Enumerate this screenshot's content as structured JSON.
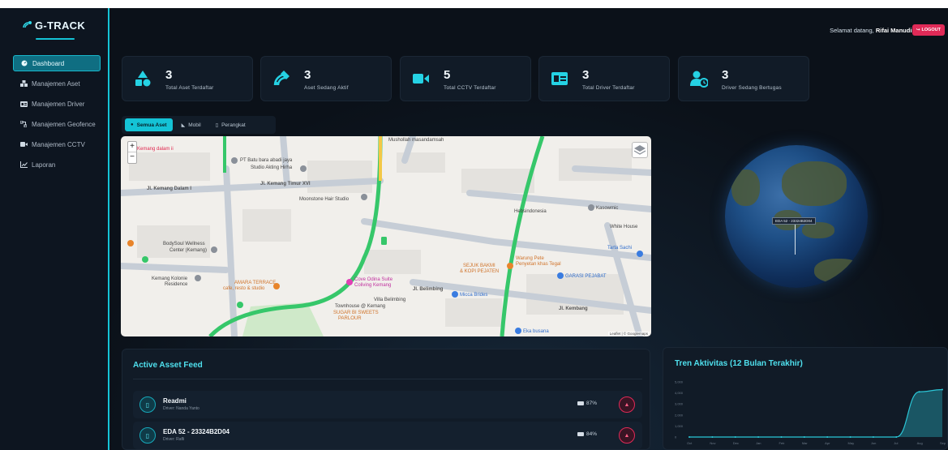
{
  "brand": {
    "name": "G-TRACK"
  },
  "nav": [
    {
      "label": "Dashboard",
      "icon": "dashboard-icon",
      "active": true
    },
    {
      "label": "Manajemen Aset",
      "icon": "assets-icon"
    },
    {
      "label": "Manajemen Driver",
      "icon": "id-card-icon"
    },
    {
      "label": "Manajemen Geofence",
      "icon": "geofence-icon"
    },
    {
      "label": "Manajemen CCTV",
      "icon": "video-icon"
    },
    {
      "label": "Laporan",
      "icon": "chart-icon"
    }
  ],
  "header": {
    "greeting": "Selamat datang,",
    "user": "Rifai Manudin",
    "logout": "LOGOUT"
  },
  "stats": [
    {
      "value": "3",
      "label": "Total Aset Terdaftar",
      "icon": "shapes-icon"
    },
    {
      "value": "3",
      "label": "Aset Sedang Aktif",
      "icon": "satellite-icon"
    },
    {
      "value": "5",
      "label": "Total CCTV Terdaftar",
      "icon": "video-icon"
    },
    {
      "value": "3",
      "label": "Total Driver Terdaftar",
      "icon": "id-card-icon"
    },
    {
      "value": "3",
      "label": "Driver Sedang Bertugas",
      "icon": "user-clock-icon"
    }
  ],
  "filters": [
    {
      "label": "Semua Aset",
      "icon": "globe-icon",
      "active": true
    },
    {
      "label": "Mobil",
      "icon": "car-icon"
    },
    {
      "label": "Perangkat",
      "icon": "device-icon"
    }
  ],
  "map": {
    "labels": [
      "Kemang dalam ii",
      "PT Batu bara abadi jaya",
      "Studio Akting Hirha",
      "Jl. Kemang Dalam I",
      "Jl. Kemang Timur XVI",
      "Moonstone Hair Studio",
      "Mushollah masandamsah",
      "Hebsindonesia",
      "Kasowmic",
      "White House",
      "BodySoul Wellness",
      "Center (Kemang)",
      "Kemang Kolonie",
      "Residence",
      "AMARA TERRACE",
      "cafe, resto & studio",
      "Cove Odina Suite",
      "Coliving Kemang",
      "Jl. Belimbing",
      "Micca Brides",
      "SEJUK BAKMI",
      "& KOPI PEJATEN",
      "Warung Pete",
      "Penyetan khas Tegal",
      "GARASI PEJABAT",
      "Tarta Sachi",
      "Villa Belimbing",
      "Townhouse @ Kemang",
      "SUGAR BI SWEETS",
      "PARLOUR",
      "Eka busana",
      "Jl. Kembang"
    ],
    "zoom_in": "+",
    "zoom_out": "−",
    "attribution": "Leaflet | © Googlemaps"
  },
  "globe": {
    "marker_label": "EDA 52 - 23324B2D04"
  },
  "feed": {
    "title": "Active Asset Feed",
    "rows": [
      {
        "name": "Readmi",
        "driver": "Driver: Nanda Yanto",
        "battery": "87%"
      },
      {
        "name": "EDA 52 - 23324B2D04",
        "driver": "Driver: Rafli",
        "battery": "84%"
      }
    ]
  },
  "trend": {
    "title": "Tren Aktivitas (12 Bulan Terakhir)"
  },
  "chart_data": {
    "type": "area",
    "title": "Tren Aktivitas (12 Bulan Terakhir)",
    "categories": [
      "Oct",
      "Nov",
      "Dec",
      "Jan",
      "Feb",
      "Mar",
      "Apr",
      "May",
      "Jun",
      "Jul",
      "Aug",
      "Sep"
    ],
    "values": [
      0,
      0,
      0,
      0,
      0,
      0,
      0,
      0,
      0,
      0,
      4100,
      4300
    ],
    "y_ticks": [
      "5,000",
      "4,000",
      "3,000",
      "2,000",
      "1,000",
      "0"
    ],
    "ylim": [
      0,
      5000
    ],
    "color": "#2bc6d6"
  }
}
